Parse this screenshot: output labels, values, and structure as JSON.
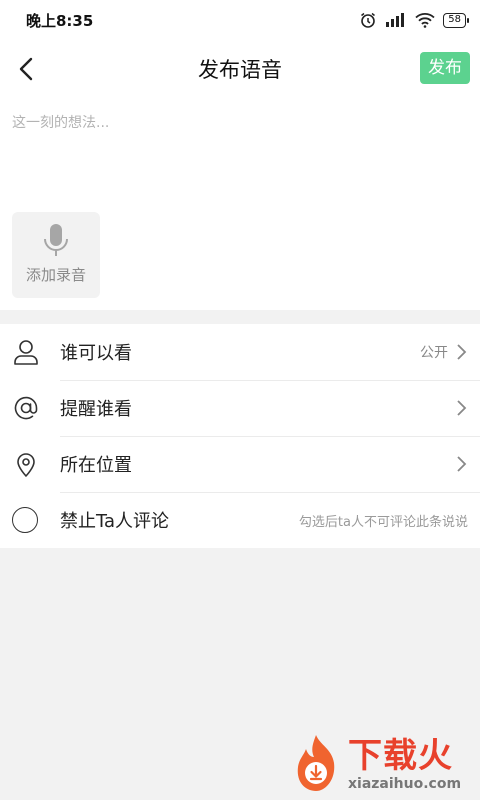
{
  "status_bar": {
    "time": "晚上8:35",
    "battery": "58"
  },
  "header": {
    "title": "发布语音",
    "publish_label": "发布"
  },
  "compose": {
    "placeholder": "这一刻的想法...",
    "add_audio_label": "添加录音"
  },
  "options": {
    "visibility": {
      "label": "谁可以看",
      "value": "公开"
    },
    "mention": {
      "label": "提醒谁看"
    },
    "location": {
      "label": "所在位置"
    },
    "no_comment": {
      "label": "禁止Ta人评论",
      "hint": "勾选后ta人不可评论此条说说"
    }
  },
  "watermark": {
    "cn": "下载火",
    "en": "xiazaihuo.com"
  },
  "colors": {
    "accent": "#5cd28f",
    "watermark": "#e8412c"
  }
}
